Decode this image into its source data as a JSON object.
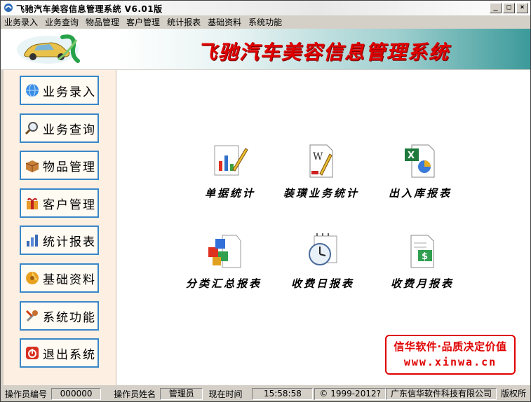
{
  "window": {
    "title": "飞驰汽车美容信息管理系统   V6.01版",
    "min_label": "_",
    "max_label": "□",
    "close_label": "×"
  },
  "menu": [
    "业务录入",
    "业务查询",
    "物品管理",
    "客户管理",
    "统计报表",
    "基础资料",
    "系统功能"
  ],
  "banner": {
    "title": "飞驰汽车美容信息管理系统"
  },
  "sidebar": [
    {
      "label": "业务录入",
      "icon": "globe-icon"
    },
    {
      "label": "业务查询",
      "icon": "magnifier-icon"
    },
    {
      "label": "物品管理",
      "icon": "box-icon"
    },
    {
      "label": "客户管理",
      "icon": "gift-icon"
    },
    {
      "label": "统计报表",
      "icon": "bar-chart-icon"
    },
    {
      "label": "基础资料",
      "icon": "database-icon"
    },
    {
      "label": "系统功能",
      "icon": "tools-icon"
    },
    {
      "label": "退出系统",
      "icon": "power-icon"
    }
  ],
  "tiles": [
    {
      "label": "单据统计",
      "icon": "chart-pencil-icon"
    },
    {
      "label": "装璜业务统计",
      "icon": "word-document-icon"
    },
    {
      "label": "出入库报表",
      "icon": "excel-document-icon"
    },
    {
      "label": "分类汇总报表",
      "icon": "cubes-icon"
    },
    {
      "label": "收费日报表",
      "icon": "clock-calendar-icon"
    },
    {
      "label": "收费月报表",
      "icon": "money-document-icon"
    }
  ],
  "ad": {
    "line1": "信华软件·品质决定价值",
    "line2": "www.xinwa.cn"
  },
  "status": {
    "operator_id_label": "操作员编号",
    "operator_id": "000000",
    "operator_name_label": "操作员姓名",
    "operator_name": "管理员",
    "time_label": "现在时间",
    "time": "15:58:58",
    "copyright": "©  1999-2012?",
    "company": "广东信华软件科技有限公司",
    "rights": "版权所"
  },
  "colors": {
    "banner_title": "#e00000",
    "nav_border": "#3a86c8",
    "sidebar_bg": "#fdf0e2",
    "ad_red": "#e00000"
  }
}
